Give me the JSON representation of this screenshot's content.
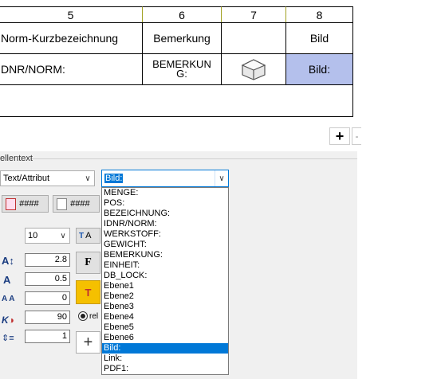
{
  "table": {
    "columns": [
      "5",
      "6",
      "7",
      "8"
    ],
    "row1": [
      "Norm-Kurzbezeichnung",
      "Bemerkung",
      "",
      "Bild"
    ],
    "row2": [
      "DNR/NORM:",
      "BEMERKUN\nG:",
      "",
      "Bild:"
    ]
  },
  "toolbar": {
    "plus_label": "+",
    "minus_label": "-"
  },
  "panel": {
    "group_label": "ellentext",
    "type_select": "Text/Attribut",
    "attr_select": "Bild:",
    "hash1": "####",
    "hash2": "####",
    "fontsize_select": "10",
    "format_button_partial": "A",
    "inputs": [
      "2.8",
      "0.5",
      "0",
      "90",
      "1"
    ],
    "bold_label": "F",
    "radio_label": "rel"
  },
  "dropdown": {
    "items": [
      "MENGE:",
      "POS:",
      "BEZEICHNUNG:",
      "IDNR/NORM:",
      "WERKSTOFF:",
      "GEWICHT:",
      "BEMERKUNG:",
      "EINHEIT:",
      "DB_LOCK:",
      "Ebene1",
      "Ebene2",
      "Ebene3",
      "Ebene4",
      "Ebene5",
      "Ebene6",
      "Bild:",
      "Link:",
      "PDF1:"
    ],
    "selected_index": 15
  },
  "colors": {
    "highlight_cell": "#b4c0ec",
    "selection": "#0078d7",
    "yellow_button": "#f5c000"
  }
}
